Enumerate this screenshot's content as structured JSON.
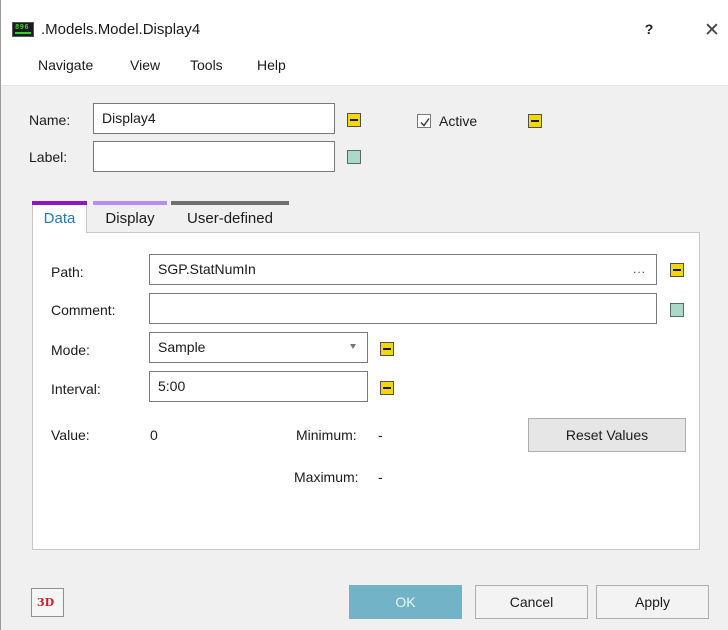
{
  "window": {
    "title": ".Models.Model.Display4",
    "app_icon_text": "896",
    "help_label": "?",
    "close_label": "✕"
  },
  "menu": {
    "items": [
      "Navigate",
      "View",
      "Tools",
      "Help"
    ]
  },
  "header_form": {
    "name_label": "Name:",
    "name_value": "Display4",
    "label_label": "Label:",
    "label_value": "",
    "active_label": "Active",
    "active_checked": true
  },
  "tabs": [
    {
      "label": "Data",
      "selected": true,
      "color": "#8a18c6"
    },
    {
      "label": "Display",
      "selected": false,
      "color": "#b68ef2"
    },
    {
      "label": "User-defined",
      "selected": false,
      "color": "#707070"
    }
  ],
  "data_tab": {
    "path_label": "Path:",
    "path_value": "SGP.StatNumIn",
    "path_browse": "...",
    "comment_label": "Comment:",
    "comment_value": "",
    "mode_label": "Mode:",
    "mode_value": "Sample",
    "interval_label": "Interval:",
    "interval_value": "5:00",
    "value_label": "Value:",
    "value_value": "0",
    "minimum_label": "Minimum:",
    "minimum_value": "-",
    "maximum_label": "Maximum:",
    "maximum_value": "-",
    "reset_label": "Reset Values"
  },
  "footer": {
    "three_d_label": "3D",
    "ok_label": "OK",
    "cancel_label": "Cancel",
    "apply_label": "Apply"
  },
  "colors": {
    "marker_yellow": "#f2d70a",
    "marker_teal": "#a9d9c8",
    "ok_button": "#72b3c8",
    "three_d_text": "#d21e1e"
  }
}
